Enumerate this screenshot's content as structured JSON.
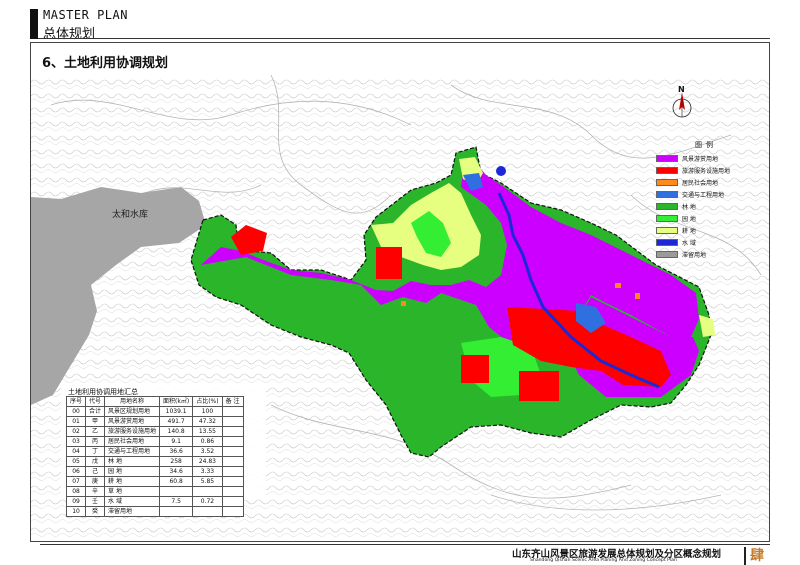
{
  "header": {
    "en": "MASTER PLAN",
    "cn": "总体规划"
  },
  "section_title": "6、土地利用协调规划",
  "map": {
    "reservoir_label": "太和水库",
    "north_label": "N",
    "legend_title": "图例",
    "legend": [
      {
        "label": "风景游赏用地",
        "color": "#cc00ff"
      },
      {
        "label": "旅游服务设施用地",
        "color": "#ff0000"
      },
      {
        "label": "居民社会用地",
        "color": "#ff8a1c"
      },
      {
        "label": "交通与工程用地",
        "color": "#2f6fe0"
      },
      {
        "label": "林  地",
        "color": "#2bb52b"
      },
      {
        "label": "园  地",
        "color": "#33ee33"
      },
      {
        "label": "耕  地",
        "color": "#e6ff80"
      },
      {
        "label": "水  域",
        "color": "#1c28d6"
      },
      {
        "label": "滞留用地",
        "color": "#9a9a9a"
      }
    ]
  },
  "table": {
    "title": "土地利用协调用地汇总",
    "headers": [
      "序号",
      "代号",
      "用地名称",
      "面积(k㎡)",
      "占比(%)",
      "备  注"
    ],
    "rows": [
      [
        "00",
        "合计",
        "风景区规划用地",
        "1039.1",
        "100",
        ""
      ],
      [
        "01",
        "甲",
        "风景游赏用地",
        "491.7",
        "47.32",
        ""
      ],
      [
        "02",
        "乙",
        "旅游服务设施用地",
        "140.8",
        "13.55",
        ""
      ],
      [
        "03",
        "丙",
        "居民社会用地",
        "9.1",
        "0.86",
        ""
      ],
      [
        "04",
        "丁",
        "交通与工程用地",
        "36.6",
        "3.52",
        ""
      ],
      [
        "05",
        "戊",
        "林  地",
        "258",
        "24.83",
        ""
      ],
      [
        "06",
        "己",
        "园  地",
        "34.6",
        "3.33",
        ""
      ],
      [
        "07",
        "庚",
        "耕  地",
        "60.8",
        "5.85",
        ""
      ],
      [
        "08",
        "辛",
        "草  地",
        "",
        "",
        ""
      ],
      [
        "09",
        "壬",
        "水  域",
        "7.5",
        "0.72",
        ""
      ],
      [
        "10",
        "癸",
        "滞留用地",
        "",
        "",
        ""
      ]
    ]
  },
  "footer": {
    "cn": "山东齐山风景区旅游发展总体规划及分区概念规划",
    "en": "Shandong Qishan Scenic Area Planing And Zoning Concept Plan",
    "glyph": "肆"
  }
}
